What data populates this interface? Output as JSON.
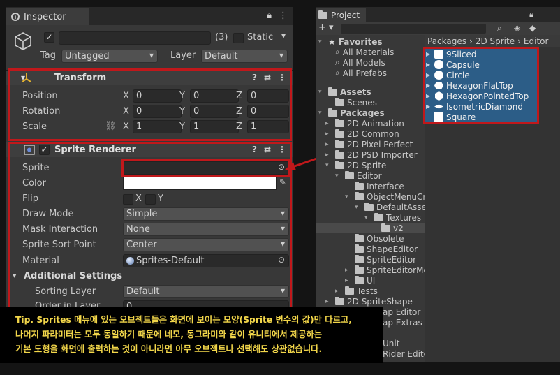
{
  "inspector": {
    "tab_label": "Inspector",
    "object_name": "—",
    "count": "(3)",
    "static_label": "Static",
    "tag_label": "Tag",
    "tag_value": "Untagged",
    "layer_label": "Layer",
    "layer_value": "Default",
    "transform": {
      "title": "Transform",
      "rows": [
        {
          "label": "Position",
          "x": "0",
          "y": "0",
          "z": "0"
        },
        {
          "label": "Rotation",
          "x": "0",
          "y": "0",
          "z": "0"
        },
        {
          "label": "Scale",
          "x": "1",
          "y": "1",
          "z": "1"
        }
      ]
    },
    "sprite_renderer": {
      "title": "Sprite Renderer",
      "sprite_label": "Sprite",
      "sprite_value": "—",
      "color_label": "Color",
      "flip_label": "Flip",
      "flip_x": "X",
      "flip_y": "Y",
      "draw_mode_label": "Draw Mode",
      "draw_mode_value": "Simple",
      "mask_label": "Mask Interaction",
      "mask_value": "None",
      "sort_point_label": "Sprite Sort Point",
      "sort_point_value": "Center",
      "material_label": "Material",
      "material_value": "Sprites-Default",
      "additional_label": "Additional Settings",
      "sorting_layer_label": "Sorting Layer",
      "sorting_layer_value": "Default",
      "order_label": "Order in Layer",
      "order_value": "0"
    }
  },
  "project": {
    "tab_label": "Project",
    "add_label": "+ ▾",
    "favorites": {
      "label": "Favorites",
      "items": [
        "All Materials",
        "All Models",
        "All Prefabs"
      ]
    },
    "assets": {
      "label": "Assets",
      "items": [
        "Scenes"
      ]
    },
    "packages": {
      "label": "Packages",
      "items": [
        "2D Animation",
        "2D Common",
        "2D Pixel Perfect",
        "2D PSD Importer",
        "2D Sprite"
      ],
      "sprite_children": [
        "Editor"
      ],
      "editor_children": [
        "Interface",
        "ObjectMenuCre"
      ],
      "objmenu_children": [
        "DefaultAsset"
      ],
      "default_children": [
        "Textures"
      ],
      "textures_children": [
        "v2"
      ],
      "after_items": [
        "Obsolete",
        "ShapeEditor",
        "SpriteEditor",
        "SpriteEditorMo",
        "UI"
      ],
      "tests": "Tests",
      "sprite_shape": "2D SpriteShape",
      "partial_items": [
        "ap Editor",
        "ap Extras",
        "Unit",
        "Rider Edito"
      ]
    },
    "breadcrumb": [
      "Packages",
      "2D Sprite",
      "Editor"
    ],
    "assets_list": [
      "9Sliced",
      "Capsule",
      "Circle",
      "HexagonFlatTop",
      "HexagonPointedTop",
      "IsometricDiamond",
      "Square"
    ]
  },
  "caption": {
    "line1": "Tip. Sprites 메뉴에 있는 오브젝트들은 화면에 보이는 모양(Sprite 변수의 값)만 다르고,",
    "line2": "나머지 파라미터는 모두 동일하기 때문에 네모, 동그라미와 같이 유니티에서 제공하는",
    "line3": "기본 도형을 화면에 출력하는 것이 아니라면 아무 오브젝트나 선택해도 상관없습니다."
  },
  "colors": {
    "highlight": "#c0181b",
    "selection": "#2c5d87",
    "caption_text": "#f2d64a"
  }
}
